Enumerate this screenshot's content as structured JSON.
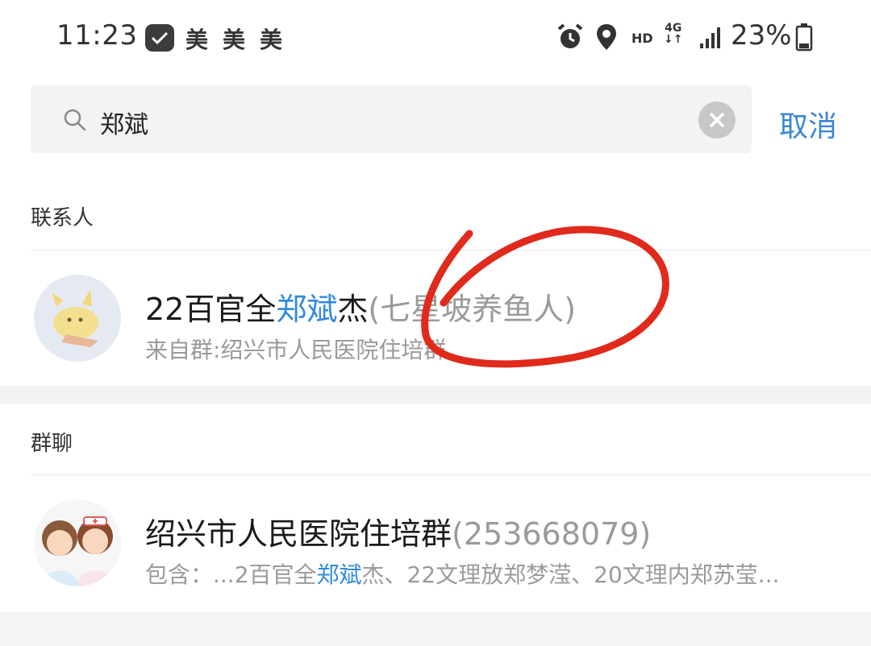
{
  "status_bar": {
    "time": "11:23",
    "carrier_icons": [
      "美",
      "美",
      "美"
    ],
    "network_hd": "HD",
    "network_type": "4G",
    "battery_percent": "23%"
  },
  "search": {
    "query": "郑斌",
    "cancel_label": "取消"
  },
  "contacts_section": {
    "label": "联系人",
    "items": [
      {
        "name_prefix": "22百官全",
        "name_highlight": "郑斌",
        "name_suffix": "杰",
        "remark": "(七星坡养鱼人)",
        "source": "来自群:绍兴市人民医院住培群"
      }
    ]
  },
  "groups_section": {
    "label": "群聊",
    "items": [
      {
        "name": "绍兴市人民医院住培群",
        "group_id": "(253668079)",
        "members_prefix": "包含：...2百官全",
        "members_highlight": "郑斌",
        "members_suffix": "杰、22文理放郑梦滢、20文理内郑苏莹..."
      }
    ]
  },
  "colors": {
    "highlight": "#2f8ae0",
    "cancel": "#3b86d6",
    "annotation": "#e02a1c"
  }
}
